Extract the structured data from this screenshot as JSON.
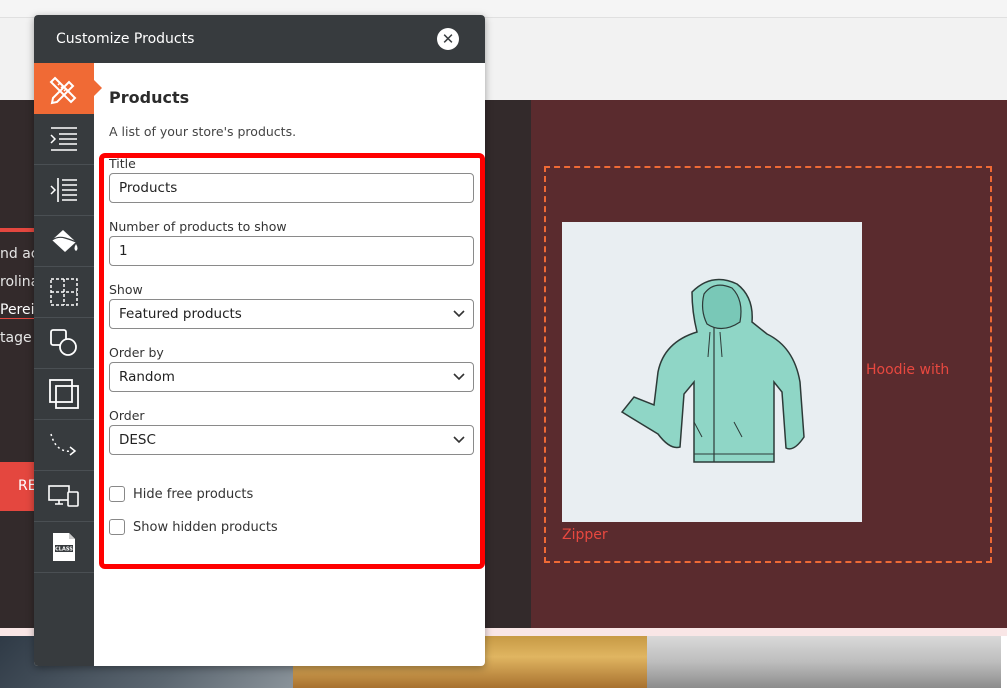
{
  "panel": {
    "title": "Customize Products",
    "close_icon": "close-icon"
  },
  "sidebar": {
    "items": [
      {
        "icon": "pencil-ruler-icon",
        "active": true
      },
      {
        "icon": "align-right-lines-icon"
      },
      {
        "icon": "indent-lines-icon"
      },
      {
        "icon": "paint-bucket-icon"
      },
      {
        "icon": "grid-dashed-icon"
      },
      {
        "icon": "shapes-icon"
      },
      {
        "icon": "layers-icon"
      },
      {
        "icon": "motion-path-icon"
      },
      {
        "icon": "devices-icon"
      },
      {
        "icon": "class-file-icon",
        "label": "CLASS"
      }
    ]
  },
  "section": {
    "title": "Products",
    "description": "A list of your store's products."
  },
  "form": {
    "title_label": "Title",
    "title_value": "Products",
    "count_label": "Number of products to show",
    "count_value": "1",
    "show_label": "Show",
    "show_value": "Featured products",
    "orderby_label": "Order by",
    "orderby_value": "Random",
    "order_label": "Order",
    "order_value": "DESC",
    "hide_free_label": "Hide free products",
    "show_hidden_label": "Show hidden products"
  },
  "background": {
    "line1": "nd ac",
    "line2": "rolina",
    "line3": "Perei",
    "line4": "tage c",
    "button": "RE",
    "product_name_part1": "Hoodie with",
    "product_name_part2": "Zipper"
  },
  "colors": {
    "accent": "#f06a35",
    "panel_dark": "#373b3e",
    "highlight": "#ff0000",
    "maroon": "#5a2b2e"
  }
}
